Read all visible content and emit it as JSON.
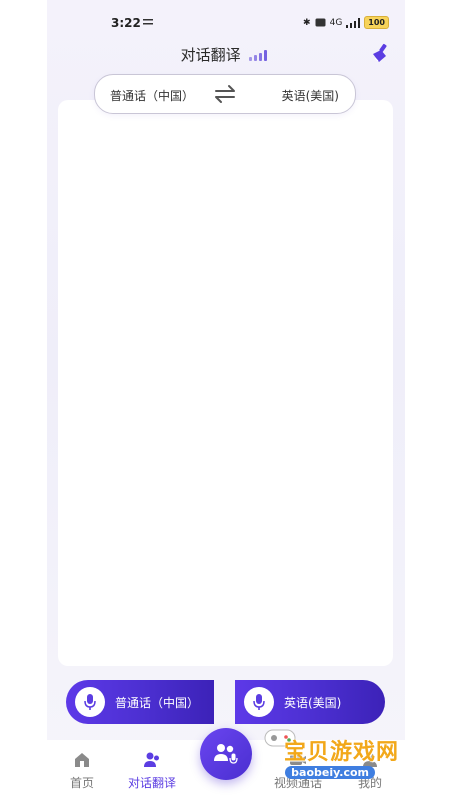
{
  "status_bar": {
    "time": "3:22",
    "network": "4G",
    "battery": "100"
  },
  "header": {
    "title": "对话翻译",
    "clean_icon": "broom-icon"
  },
  "language_selector": {
    "source": "普通话（中国）",
    "target": "英语(美国)"
  },
  "mic_buttons": {
    "left_label": "普通话（中国）",
    "right_label": "英语(美国)"
  },
  "tabbar": {
    "items": [
      {
        "label": "首页",
        "icon": "home-icon"
      },
      {
        "label": "对话翻译",
        "icon": "users-icon"
      },
      {
        "label": "视频通话",
        "icon": "video-icon"
      },
      {
        "label": "我的",
        "icon": "user-icon"
      }
    ]
  },
  "watermark": {
    "text": "宝贝游戏网",
    "url": "baobeiy.com"
  },
  "colors": {
    "accent": "#5b3de2",
    "accent_dark": "#3c22b8",
    "battery": "#f7d35a"
  }
}
